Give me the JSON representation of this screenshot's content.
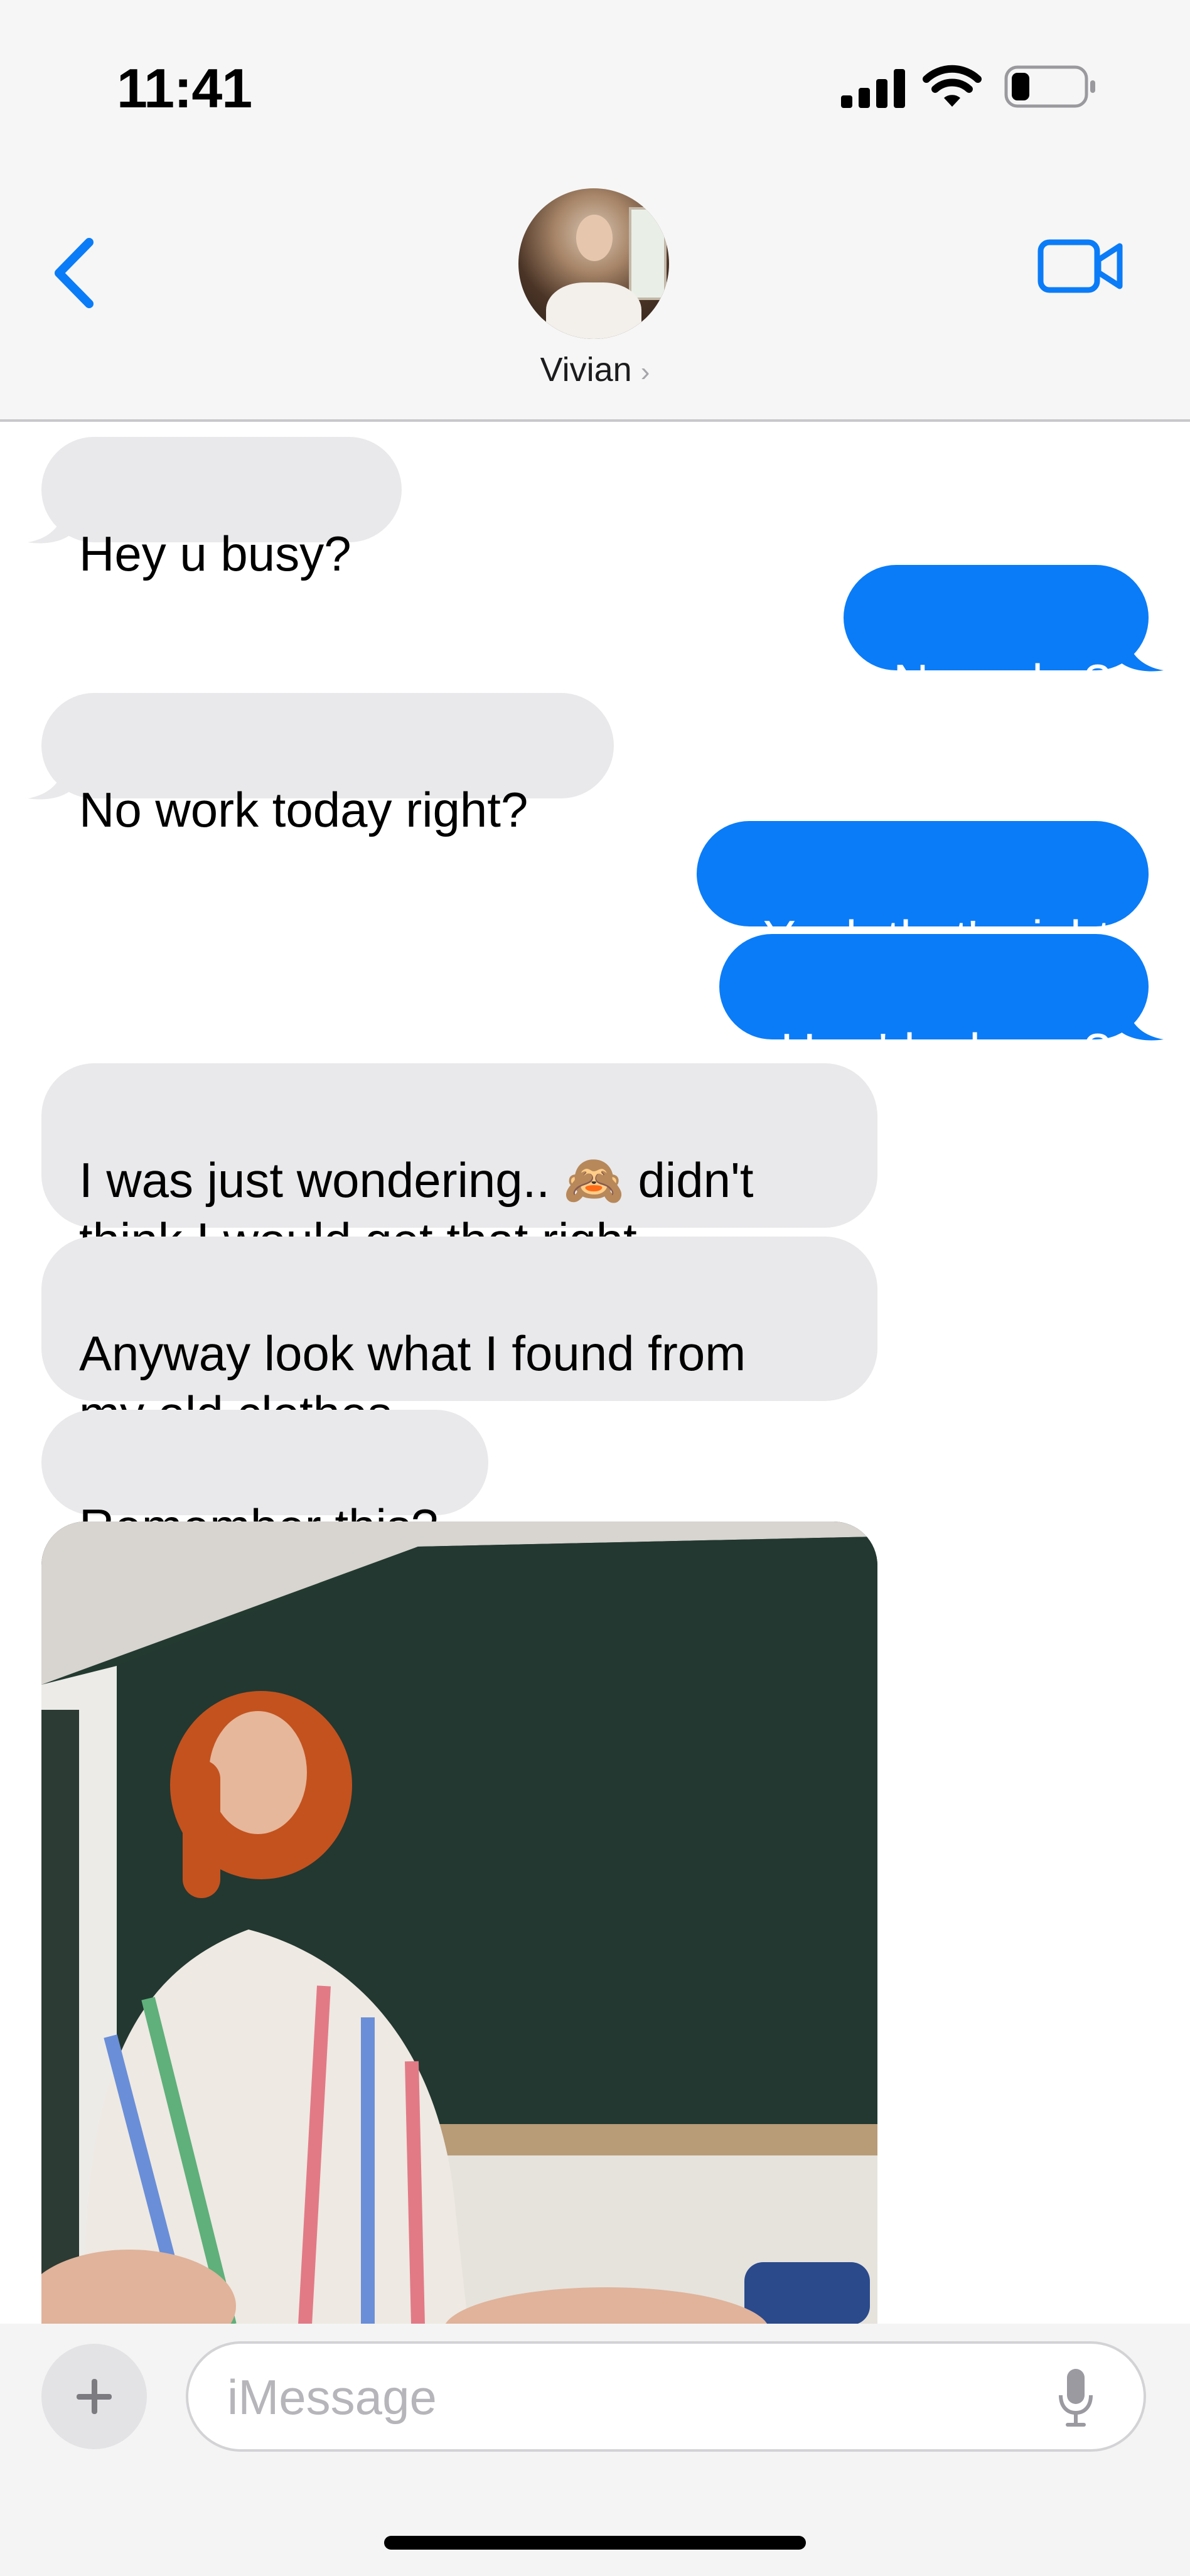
{
  "status_bar": {
    "time": "11:41",
    "signal_icon": "cellular-signal-icon",
    "wifi_icon": "wifi-icon",
    "battery_icon": "battery-icon",
    "battery_level": 0.25
  },
  "header": {
    "back_icon": "chevron-left-icon",
    "contact_name": "Vivian",
    "contact_chevron": "›",
    "video_icon": "video-camera-icon",
    "accent_color": "#0b7cf7"
  },
  "messages": [
    {
      "from": "contact",
      "text": "Hey u busy?"
    },
    {
      "from": "me",
      "text": "No.. why?"
    },
    {
      "from": "contact",
      "text": "No work today right?"
    },
    {
      "from": "me",
      "text": "Yeah that's right"
    },
    {
      "from": "me",
      "text": "How'd u know?"
    },
    {
      "from": "contact",
      "text": "I was just wondering.. 🙈 didn't\nthink I would get that right"
    },
    {
      "from": "contact",
      "text": "Anyway look what I found from\nmy old clothes"
    },
    {
      "from": "contact",
      "text": "Remember this?"
    },
    {
      "from": "contact",
      "type": "photo"
    }
  ],
  "input": {
    "plus_icon": "plus-icon",
    "placeholder": "iMessage",
    "mic_icon": "microphone-icon"
  },
  "colors": {
    "incoming_bubble": "#e9e9eb",
    "outgoing_bubble": "#0b7cf7",
    "header_bg": "#f6f6f6"
  }
}
